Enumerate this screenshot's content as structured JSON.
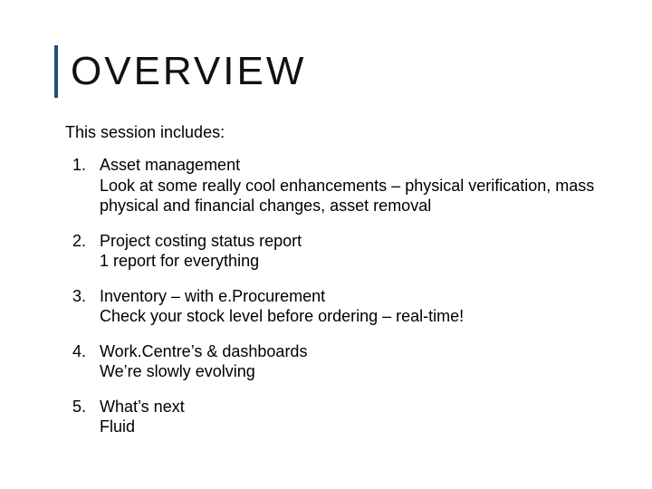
{
  "title": "OVERVIEW",
  "intro": "This session includes:",
  "items": [
    {
      "title": "Asset management",
      "desc": "Look at some really cool enhancements – physical verification, mass physical and financial changes, asset removal"
    },
    {
      "title": "Project costing status report",
      "desc": "1 report for everything"
    },
    {
      "title": "Inventory – with e.Procurement",
      "desc": "Check your stock level before ordering – real-time!"
    },
    {
      "title": "Work.Centre’s & dashboards",
      "desc": "We’re slowly evolving"
    },
    {
      "title": "What’s next",
      "desc": "Fluid"
    }
  ]
}
